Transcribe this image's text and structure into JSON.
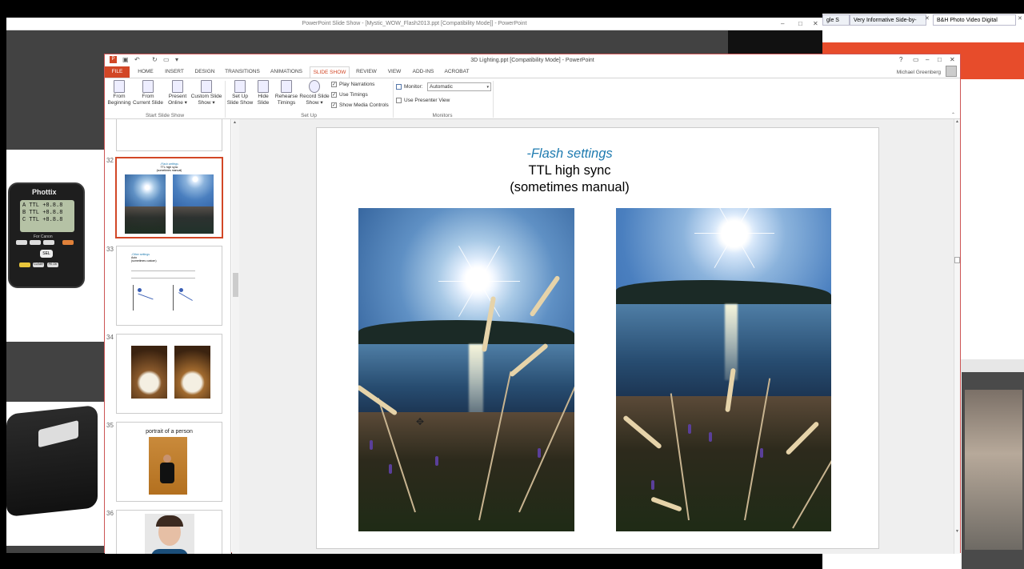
{
  "background_window": {
    "title": "PowerPoint Slide Show - [Mystic_WOW_Flash2013.ppt [Compatibility Mode]] - PowerPoint",
    "controls": [
      "–",
      "□",
      "✕"
    ]
  },
  "browser": {
    "tabs": [
      "gle S",
      "Very Informative Side-by-",
      "B&H Photo Video Digital"
    ],
    "tab_close": "✕"
  },
  "device": {
    "brand": "Phottix",
    "lcd_lines": [
      "A TTL +8.8.8",
      "B TTL +8.8.8",
      "C TTL +8.8.8"
    ],
    "buttons": [
      "SEL",
      "CLEAR",
      "PE OK"
    ],
    "label": "For Canon"
  },
  "ppt": {
    "title": "3D Lighting.ppt [Compatibility Mode] - PowerPoint",
    "window_controls": [
      "?",
      "▭",
      "–",
      "□",
      "✕"
    ],
    "qat_icons": [
      "powerpoint-logo-icon",
      "save-icon",
      "undo-icon",
      "redo-icon",
      "start-icon",
      "customize-icon"
    ],
    "tabs": [
      "FILE",
      "HOME",
      "INSERT",
      "DESIGN",
      "TRANSITIONS",
      "ANIMATIONS",
      "SLIDE SHOW",
      "REVIEW",
      "VIEW",
      "ADD-INS",
      "ACROBAT"
    ],
    "active_tab": "SLIDE SHOW",
    "user": "Michael Greenberg",
    "ribbon": {
      "start_group": {
        "label": "Start Slide Show",
        "buttons": [
          {
            "l1": "From",
            "l2": "Beginning"
          },
          {
            "l1": "From",
            "l2": "Current Slide"
          },
          {
            "l1": "Present",
            "l2": "Online ▾"
          },
          {
            "l1": "Custom Slide",
            "l2": "Show ▾"
          }
        ]
      },
      "setup_group": {
        "label": "Set Up",
        "buttons": [
          {
            "l1": "Set Up",
            "l2": "Slide Show"
          },
          {
            "l1": "Hide",
            "l2": "Slide"
          },
          {
            "l1": "Rehearse",
            "l2": "Timings"
          },
          {
            "l1": "Record Slide",
            "l2": "Show ▾"
          }
        ],
        "checks": [
          {
            "label": "Play Narrations",
            "checked": true
          },
          {
            "label": "Use Timings",
            "checked": true
          },
          {
            "label": "Show Media Controls",
            "checked": true
          }
        ]
      },
      "monitors_group": {
        "label": "Monitors",
        "monitor_label": "Monitor:",
        "monitor_value": "Automatic",
        "presenter_view": "Use Presenter View"
      }
    },
    "slide_numbers": [
      "32",
      "33",
      "34",
      "35",
      "36"
    ],
    "thumbnails": {
      "t32": [
        "-Flash settings",
        "TTL high sync",
        "(sometimes manual)"
      ],
      "t33": [
        "-Other settings",
        "Auto",
        "(sometimes custom)"
      ],
      "t35": "portrait of a person"
    },
    "slide": {
      "title": "-Flash settings",
      "line2": "TTL high sync",
      "line3": "(sometimes manual)"
    }
  }
}
